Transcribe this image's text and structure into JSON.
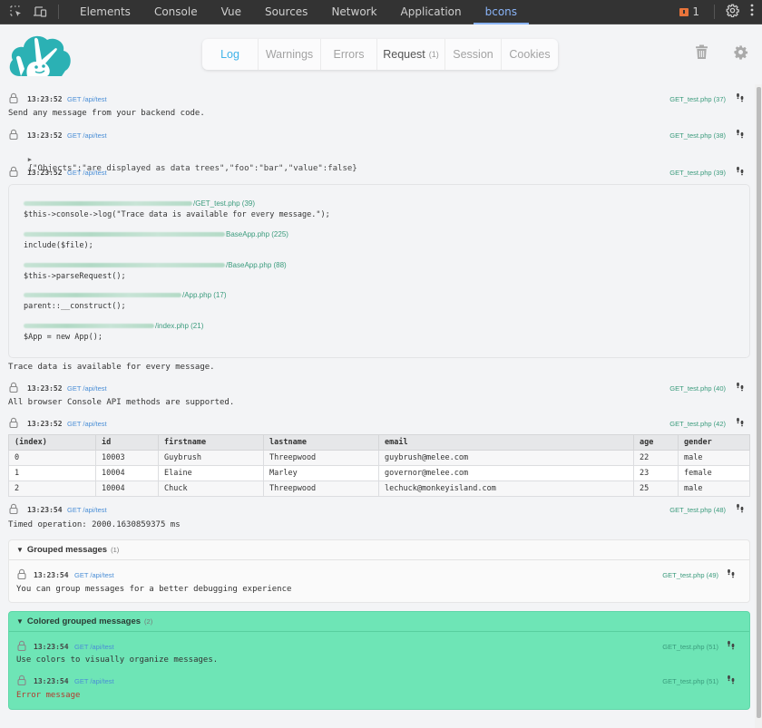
{
  "devtools": {
    "tabs": [
      {
        "label": "Elements"
      },
      {
        "label": "Console"
      },
      {
        "label": "Vue"
      },
      {
        "label": "Sources"
      },
      {
        "label": "Network"
      },
      {
        "label": "Application"
      },
      {
        "label": "bcons",
        "active": true
      }
    ],
    "issues_count": "1",
    "accent_color": "#8ab4f8"
  },
  "app": {
    "logo_name": "bcons",
    "tabs": [
      {
        "label": "Log",
        "active": true
      },
      {
        "label": "Warnings"
      },
      {
        "label": "Errors"
      },
      {
        "label": "Request",
        "count": "(1)"
      },
      {
        "label": "Session"
      },
      {
        "label": "Cookies"
      }
    ],
    "icons": {
      "clear": "trash-icon",
      "settings": "gear-icon"
    },
    "brand_color": "#2bb1b4"
  },
  "log": [
    {
      "time": "13:23:52",
      "request": "GET /api/test",
      "file": "GET_test.php (37)",
      "message": "Send any message from your backend code."
    },
    {
      "time": "13:23:52",
      "request": "GET /api/test",
      "file": "GET_test.php (38)",
      "message": "{\"Objects\":\"are displayed as data trees\",\"foo\":\"bar\",\"value\":false}"
    },
    {
      "time": "13:23:52",
      "request": "GET /api/test",
      "file": "GET_test.php (39)",
      "message": "Trace data is available for every message.",
      "trace": [
        {
          "file": "/GET_test.php (39)",
          "code": "$this->console->log(\"Trace data is available for every message.\");"
        },
        {
          "file": "BaseApp.php (225)",
          "code": "include($file);"
        },
        {
          "file": "/BaseApp.php (88)",
          "code": "$this->parseRequest();"
        },
        {
          "file": "/App.php (17)",
          "code": "parent::__construct();"
        },
        {
          "file": "/index.php (21)",
          "code": "$App = new App();"
        }
      ]
    },
    {
      "time": "13:23:52",
      "request": "GET /api/test",
      "file": "GET_test.php (40)",
      "message": "All browser Console API methods are supported."
    },
    {
      "time": "13:23:52",
      "request": "GET /api/test",
      "file": "GET_test.php (42)",
      "table": {
        "columns": [
          "(index)",
          "id",
          "firstname",
          "lastname",
          "email",
          "age",
          "gender"
        ],
        "rows": [
          [
            "0",
            "10003",
            "Guybrush",
            "Threepwood",
            "guybrush@melee.com",
            "22",
            "male"
          ],
          [
            "1",
            "10004",
            "Elaine",
            "Marley",
            "governor@melee.com",
            "23",
            "female"
          ],
          [
            "2",
            "10004",
            "Chuck",
            "Threepwood",
            "lechuck@monkeyisland.com",
            "25",
            "male"
          ]
        ]
      }
    },
    {
      "time": "13:23:54",
      "request": "GET /api/test",
      "file": "GET_test.php (48)",
      "message": "Timed operation: 2000.1630859375 ms"
    }
  ],
  "groups": [
    {
      "title": "Grouped messages",
      "count": "(1)",
      "color": "#fafafa",
      "items": [
        {
          "time": "13:23:54",
          "request": "GET /api/test",
          "file": "GET_test.php (49)",
          "message": "You can group messages for a better debugging experience"
        }
      ]
    },
    {
      "title": "Colored grouped messages",
      "count": "(2)",
      "color": "#6ee5b6",
      "items": [
        {
          "time": "13:23:54",
          "request": "GET /api/test",
          "file": "GET_test.php (51)",
          "message": "Use colors to visually organize messages."
        },
        {
          "time": "13:23:54",
          "request": "GET /api/test",
          "file": "GET_test.php (51)",
          "message": "Error message",
          "level": "error"
        }
      ]
    }
  ]
}
